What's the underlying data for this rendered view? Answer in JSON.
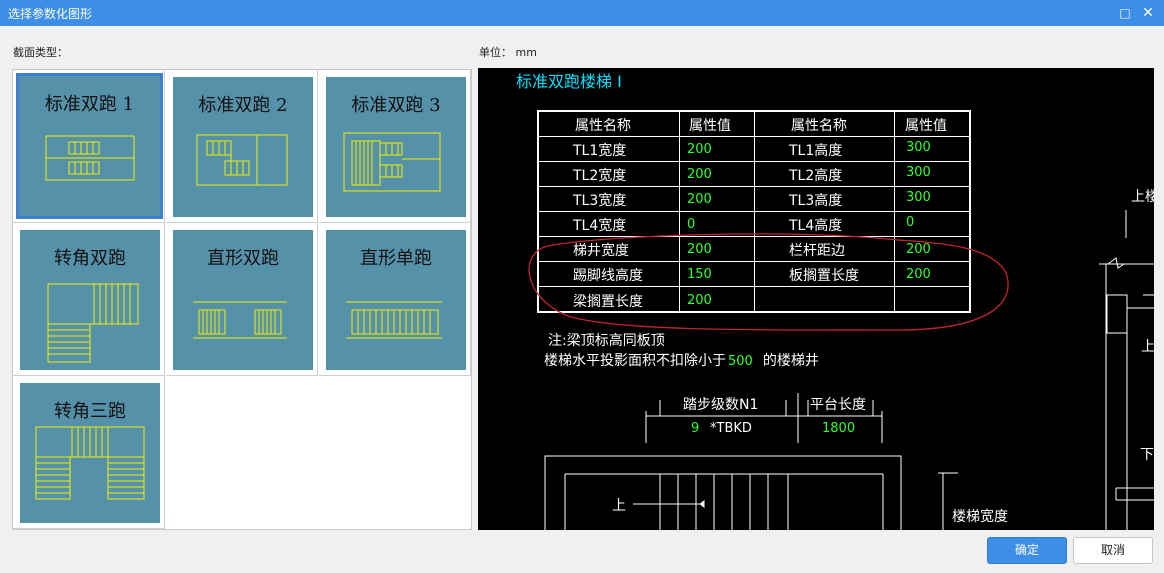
{
  "window": {
    "title": "选择参数化图形",
    "maximize_icon": "□",
    "close_icon": "✕"
  },
  "labels": {
    "section_type": "截面类型：",
    "unit": "单位：  mm"
  },
  "thumbnails": [
    {
      "label": "标准双跑 1",
      "selected": true
    },
    {
      "label": "标准双跑 2",
      "selected": false
    },
    {
      "label": "标准双跑 3",
      "selected": false
    },
    {
      "label": "转角双跑",
      "selected": false
    },
    {
      "label": "直形双跑",
      "selected": false
    },
    {
      "label": "直形单跑",
      "selected": false
    },
    {
      "label": "转角三跑",
      "selected": false
    }
  ],
  "preview": {
    "title": "标准双跑楼梯 I",
    "table": {
      "headers": [
        "属性名称",
        "属性值",
        "属性名称",
        "属性值"
      ],
      "rows": [
        [
          "TL1宽度",
          "200",
          "TL1高度",
          "300"
        ],
        [
          "TL2宽度",
          "200",
          "TL2高度",
          "300"
        ],
        [
          "TL3宽度",
          "200",
          "TL3高度",
          "300"
        ],
        [
          "TL4宽度",
          "0",
          "TL4高度",
          "0"
        ],
        [
          "梯井宽度",
          "200",
          "栏杆距边",
          "200"
        ],
        [
          "踢脚线高度",
          "150",
          "板搁置长度",
          "200"
        ],
        [
          "梁搁置长度",
          "200",
          "",
          ""
        ]
      ]
    },
    "note_line1": "注:梁顶标高同板顶",
    "note_line2_a": "楼梯水平投影面积不扣除小于",
    "note_line2_value": "500",
    "note_line2_b": "的楼梯井",
    "dim_steps_label": "踏步级数N1",
    "dim_platform_label": "平台长度",
    "dim_steps_value": "9",
    "dim_steps_formula": "*TBKD",
    "dim_platform_value": "1800",
    "up_label": "上",
    "right_up_label1": "上楼",
    "right_up_label2": "上",
    "right_down_label": "下",
    "stair_width_label": "楼梯宽度"
  },
  "buttons": {
    "ok": "确定",
    "cancel": "取消"
  },
  "colors": {
    "titlebar": "#3c8ee6",
    "tile": "#5691aa",
    "selected_border": "#3c7fd0",
    "value_green": "#30ff30",
    "title_cyan": "#00e0ff",
    "annotation_red": "#c0262e",
    "stair_yellow": "#f0f000"
  }
}
